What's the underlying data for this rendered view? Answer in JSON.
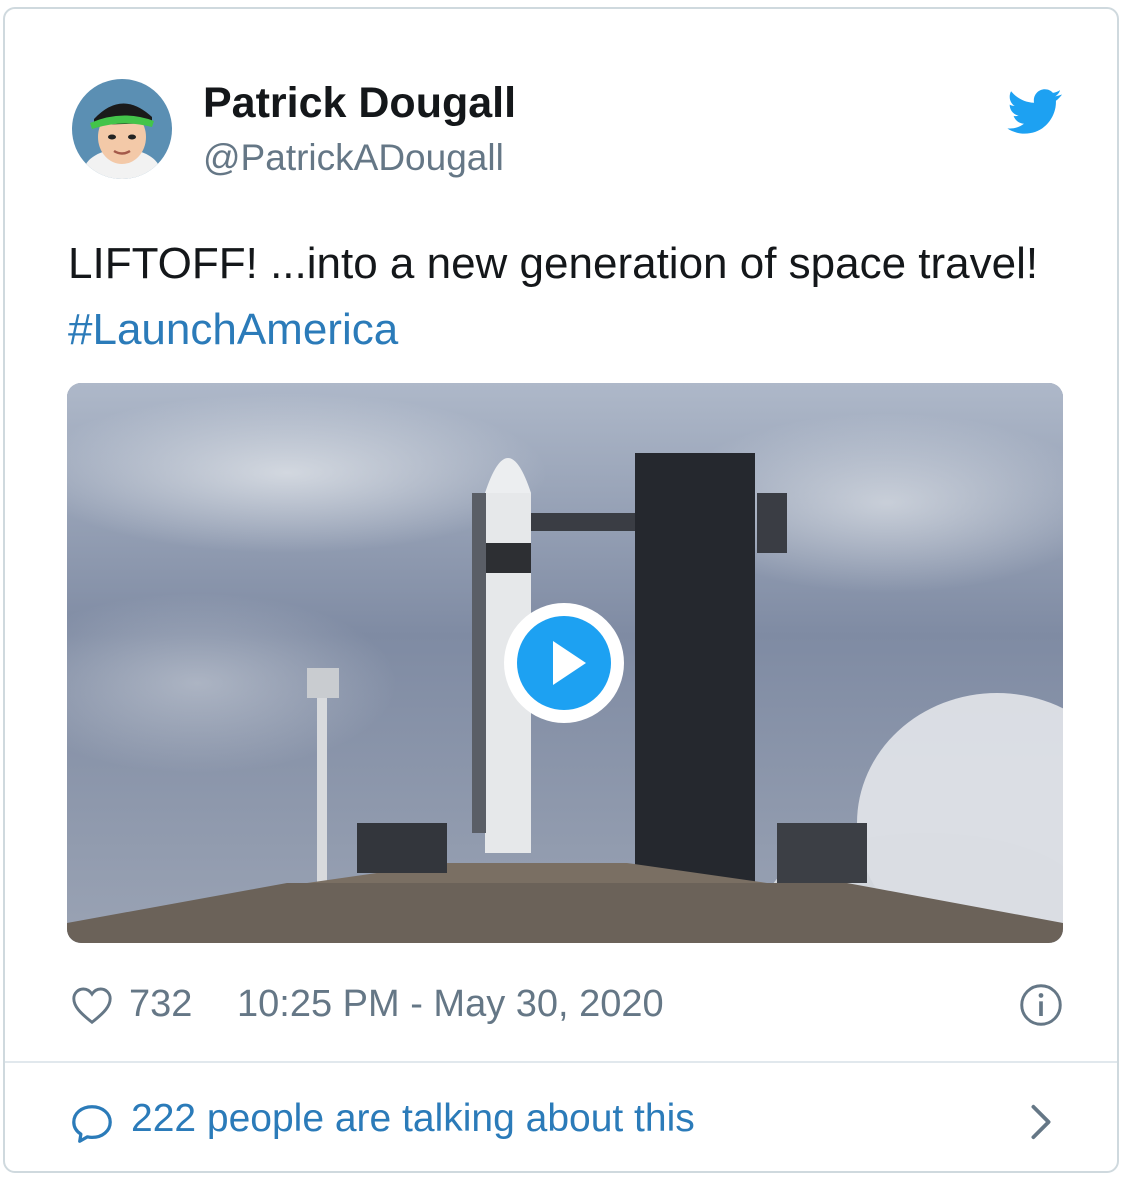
{
  "author": {
    "name": "Patrick Dougall",
    "handle": "@PatrickADougall"
  },
  "tweet": {
    "text": "LIFTOFF! ...into a new generation of space travel! ",
    "hashtag": "#LaunchAmerica"
  },
  "media": {
    "type": "video",
    "play_icon": "play-icon"
  },
  "stats": {
    "likes": "732",
    "timestamp": "10:25 PM - May 30, 2020"
  },
  "conversation": {
    "label": "222 people are talking about this"
  },
  "colors": {
    "link": "#2b7bb9",
    "twitter_blue": "#1da1f2",
    "muted": "#657786",
    "text": "#14171a",
    "border": "#cfd9de"
  },
  "icons": {
    "brand": "twitter-bird-icon",
    "like": "heart-icon",
    "info": "info-icon",
    "reply": "comment-bubble-icon",
    "more": "chevron-right-icon"
  }
}
